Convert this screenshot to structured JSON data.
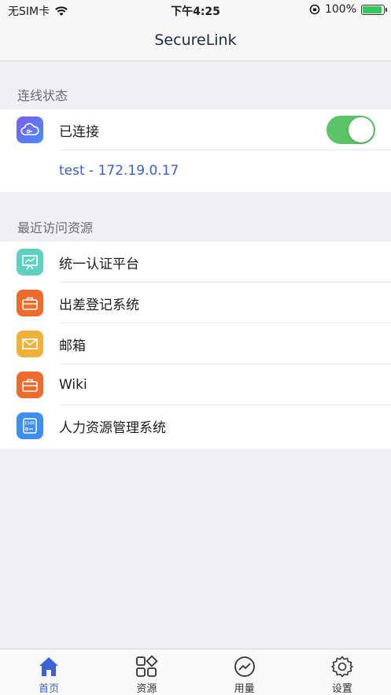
{
  "status_bar": {
    "carrier": "无SIM卡",
    "time": "下午4:25",
    "battery": "100%"
  },
  "nav": {
    "title": "SecureLink"
  },
  "connection": {
    "section_title": "连线状态",
    "status_label": "已连接",
    "toggle_on": true,
    "detail": "test - 172.19.0.17"
  },
  "recent": {
    "section_title": "最近访问资源",
    "items": [
      {
        "label": "统一认证平台",
        "icon": "presentation-icon",
        "color": "#5fd1c1"
      },
      {
        "label": "出差登记系统",
        "icon": "briefcase-icon",
        "color": "#ee6a2d"
      },
      {
        "label": "邮箱",
        "icon": "mail-icon",
        "color": "#f0b13c"
      },
      {
        "label": "Wiki",
        "icon": "briefcase-icon",
        "color": "#ee6a2d"
      },
      {
        "label": "人力资源管理系统",
        "icon": "ehr-icon",
        "color": "#3f8ef5"
      }
    ]
  },
  "tabs": [
    {
      "label": "首页",
      "icon": "home-icon",
      "active": true
    },
    {
      "label": "资源",
      "icon": "grid-icon",
      "active": false
    },
    {
      "label": "用量",
      "icon": "chart-icon",
      "active": false
    },
    {
      "label": "设置",
      "icon": "gear-icon",
      "active": false
    }
  ],
  "colors": {
    "accent": "#3a63d8",
    "toggle": "#5ac467",
    "background": "#efeff4"
  }
}
